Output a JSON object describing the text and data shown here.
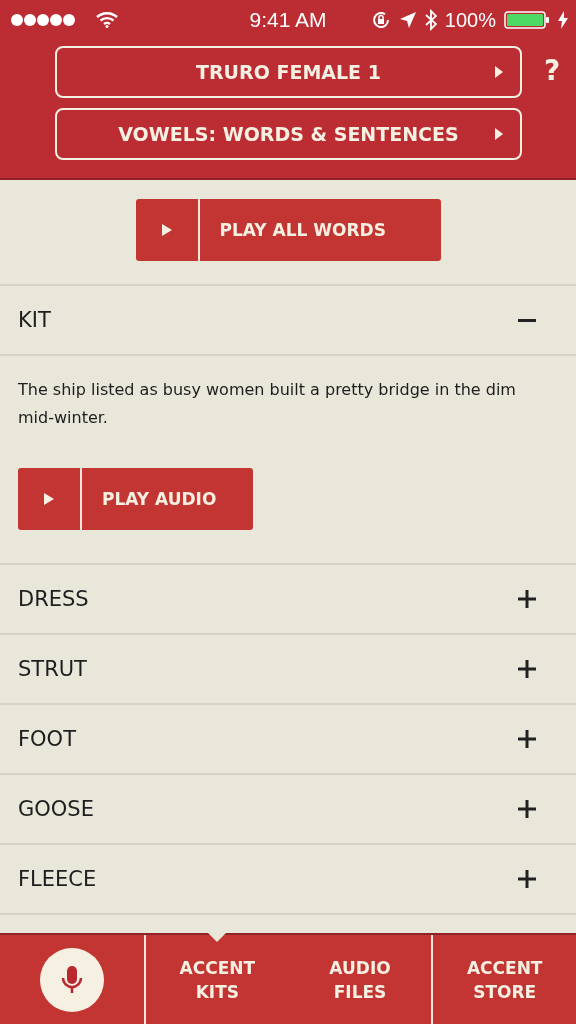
{
  "status_bar": {
    "time": "9:41 AM",
    "battery": "100%"
  },
  "header": {
    "selectors": [
      {
        "label": "TRURO FEMALE 1"
      },
      {
        "label": "VOWELS: WORDS & SENTENCES"
      }
    ],
    "help": "?"
  },
  "play_all": {
    "label": "PLAY ALL WORDS"
  },
  "items": [
    {
      "title": "KIT",
      "expanded": true,
      "sentence": "The ship listed as busy women built a pretty bridge in the dim mid-winter.",
      "button": "PLAY AUDIO"
    },
    {
      "title": "DRESS",
      "expanded": false
    },
    {
      "title": "STRUT",
      "expanded": false
    },
    {
      "title": "FOOT",
      "expanded": false
    },
    {
      "title": "GOOSE",
      "expanded": false
    },
    {
      "title": "FLEECE",
      "expanded": false
    }
  ],
  "tab_bar": [
    {
      "kind": "mic"
    },
    {
      "kind": "tab",
      "label": "ACCENT KITS",
      "selected": true
    },
    {
      "kind": "tab",
      "label": "AUDIO FILES",
      "selected": false
    },
    {
      "kind": "tab",
      "label": "ACCENT STORE",
      "selected": false
    }
  ]
}
